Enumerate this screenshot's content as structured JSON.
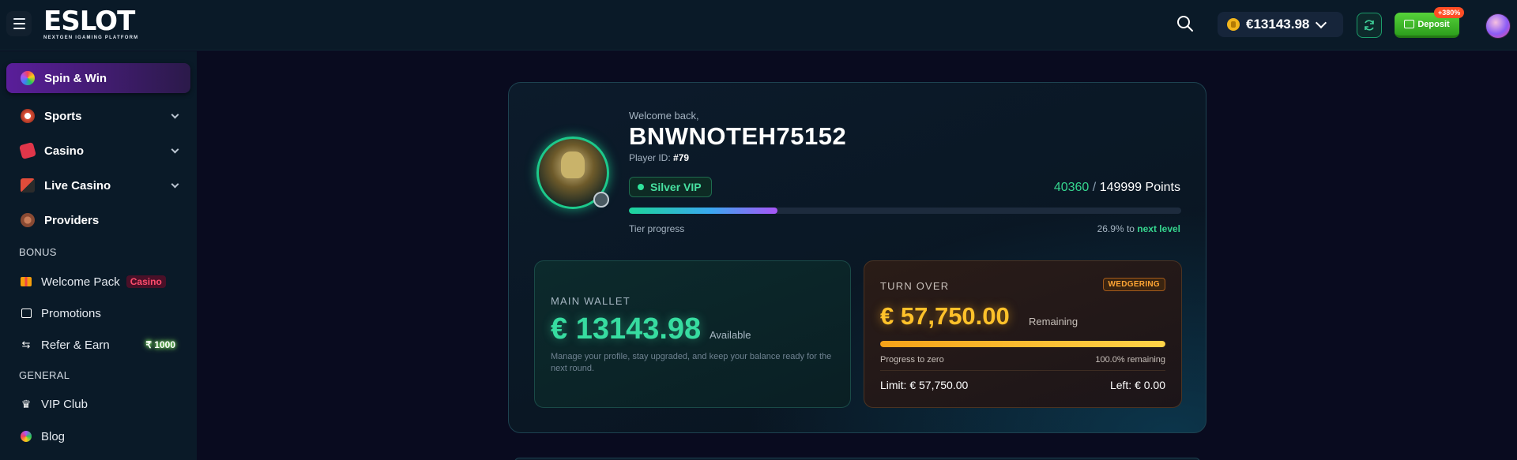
{
  "header": {
    "logo_text": "ESLOT",
    "logo_tagline": "NEXTGEN IGAMING PLATFORM",
    "balance": "€13143.98",
    "deposit_label": "Deposit",
    "deposit_badge": "+380%"
  },
  "sidebar": {
    "items": [
      {
        "label": "Spin & Win",
        "icon": "wheel-icon"
      },
      {
        "label": "Sports",
        "icon": "ball-icon"
      },
      {
        "label": "Casino",
        "icon": "dice-icon"
      },
      {
        "label": "Live Casino",
        "icon": "cards-icon"
      },
      {
        "label": "Providers",
        "icon": "chip-icon"
      }
    ],
    "bonus_label": "BONUS",
    "bonus_items": [
      {
        "label": "Welcome Pack",
        "tag": "Casino",
        "icon": "gift-icon"
      },
      {
        "label": "Promotions",
        "icon": "gift-box-icon"
      },
      {
        "label": "Refer & Earn",
        "tag": "₹ 1000",
        "icon": "refer-icon"
      }
    ],
    "general_label": "GENERAL",
    "general_items": [
      {
        "label": "VIP Club",
        "icon": "crown-icon"
      },
      {
        "label": "Blog",
        "icon": "blog-icon"
      }
    ]
  },
  "profile": {
    "welcome": "Welcome back,",
    "username": "BNWNOTEH75152",
    "player_id_label": "Player ID:",
    "player_id": "#79",
    "vip_tier": "Silver VIP",
    "points_current": "40360",
    "points_sep": "/",
    "points_total": "149999 Points",
    "tier_progress_label": "Tier progress",
    "tier_progress_pct": 26.9,
    "tier_progress_text": "26.9% to",
    "next_level": "next level"
  },
  "wallet": {
    "title": "MAIN WALLET",
    "amount": "€ 13143.98",
    "available": "Available",
    "description": "Manage your profile, stay upgraded, and keep your balance ready for the next round."
  },
  "turnover": {
    "title": "TURN OVER",
    "badge": "WEDGERING",
    "amount": "€ 57,750.00",
    "remaining_label": "Remaining",
    "progress_label": "Progress to zero",
    "progress_pct": 100.0,
    "progress_text": "100.0% remaining",
    "limit": "Limit: € 57,750.00",
    "left": "Left: € 0.00"
  },
  "colors": {
    "accent_green": "#36d68f",
    "accent_gold": "#ffc12a",
    "background": "#090b1f",
    "panel": "#0a1a28"
  }
}
